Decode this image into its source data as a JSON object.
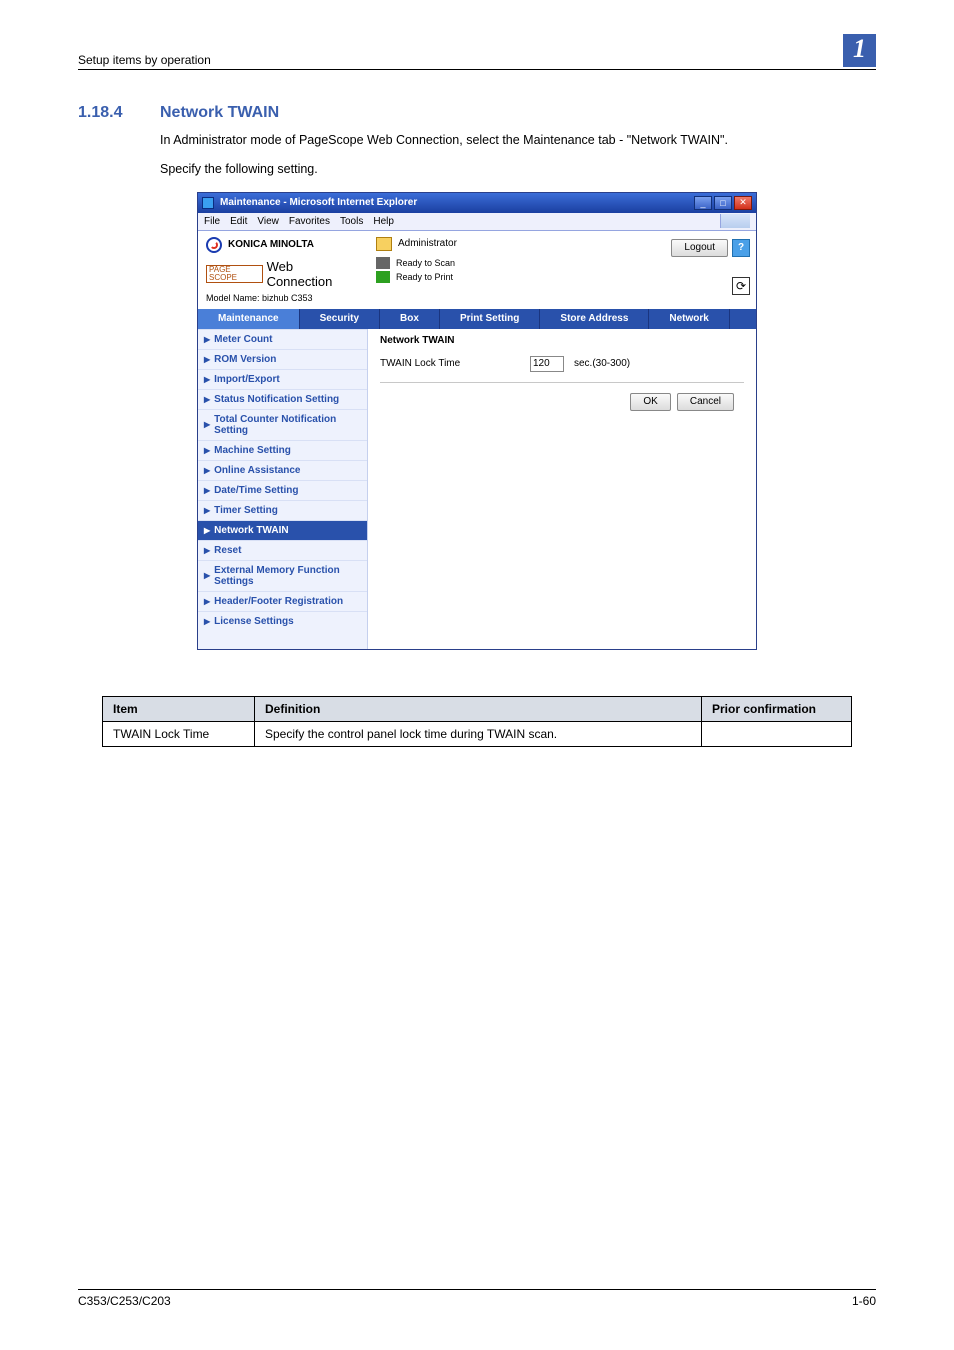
{
  "page": {
    "running_head": "Setup items by operation",
    "chapter_number": "1",
    "section_number": "1.18.4",
    "section_title": "Network TWAIN",
    "para1": "In Administrator mode of PageScope Web Connection, select the Maintenance tab - \"Network TWAIN\".",
    "para2": "Specify the following setting.",
    "footer_left": "C353/C253/C203",
    "footer_right": "1-60"
  },
  "screenshot": {
    "window_title": "Maintenance - Microsoft Internet Explorer",
    "menus": [
      "File",
      "Edit",
      "View",
      "Favorites",
      "Tools",
      "Help"
    ],
    "brand": "KONICA MINOLTA",
    "page_scope_prefix": "PAGE SCOPE",
    "web_connection": "Web Connection",
    "model_name": "Model Name: bizhub C353",
    "admin_label": "Administrator",
    "status_ready_scan": "Ready to Scan",
    "status_ready_print": "Ready to Print",
    "logout_label": "Logout",
    "tabs": [
      "Maintenance",
      "Security",
      "Box",
      "Print Setting",
      "Store Address",
      "Network"
    ],
    "active_tab_index": 0,
    "sidebar_items": [
      "Meter Count",
      "ROM Version",
      "Import/Export",
      "Status Notification Setting",
      "Total Counter Notification Setting",
      "Machine Setting",
      "Online Assistance",
      "Date/Time Setting",
      "Timer Setting",
      "Network TWAIN",
      "Reset",
      "External Memory Function Settings",
      "Header/Footer Registration",
      "License Settings"
    ],
    "active_sidebar_index": 9,
    "content_title": "Network TWAIN",
    "form_row_label": "TWAIN Lock Time",
    "form_row_value": "120",
    "form_row_suffix": "sec.(30-300)",
    "ok_label": "OK",
    "cancel_label": "Cancel"
  },
  "def_table": {
    "headers": {
      "item": "Item",
      "definition": "Definition",
      "prior": "Prior confirmation"
    },
    "rows": [
      {
        "item": "TWAIN Lock Time",
        "definition": "Specify the control panel lock time during TWAIN scan.",
        "prior": ""
      }
    ]
  }
}
